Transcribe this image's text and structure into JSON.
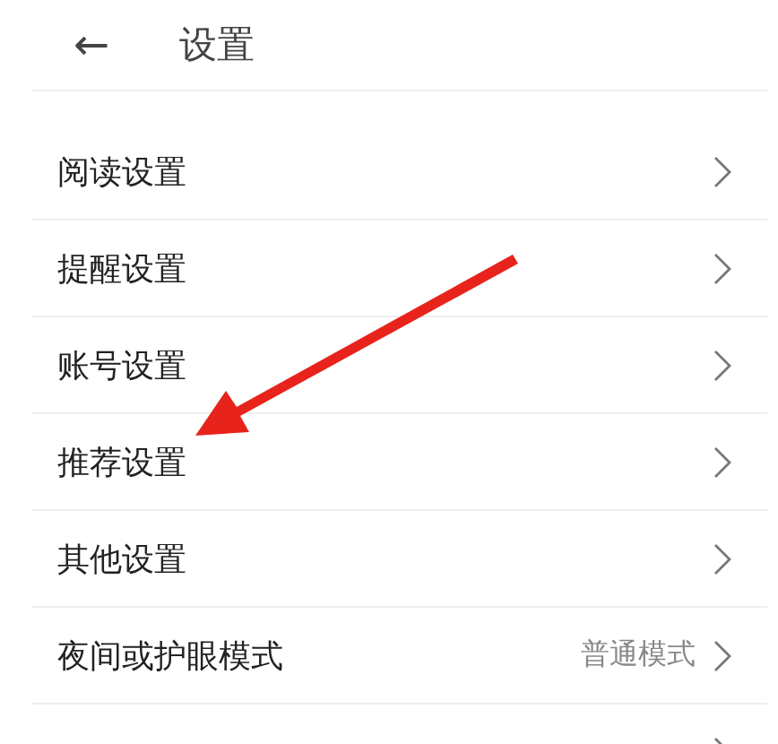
{
  "header": {
    "back_icon": "←",
    "title": "设置"
  },
  "rows": [
    {
      "label": "阅读设置"
    },
    {
      "label": "提醒设置"
    },
    {
      "label": "账号设置"
    },
    {
      "label": "推荐设置"
    },
    {
      "label": "其他设置"
    },
    {
      "label": "夜间或护眼模式",
      "value": "普通模式"
    },
    {}
  ]
}
